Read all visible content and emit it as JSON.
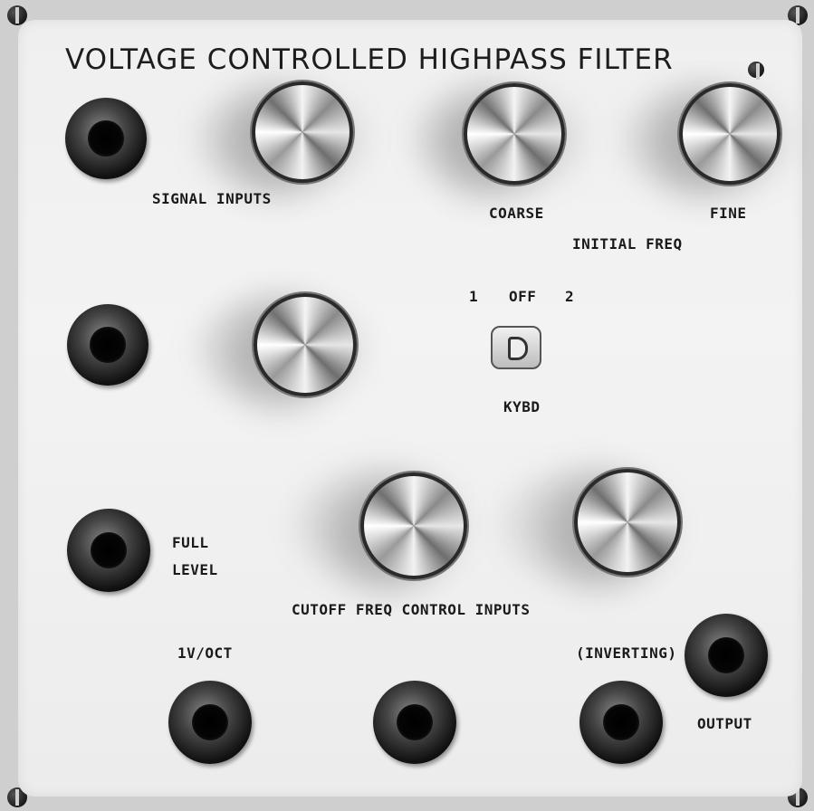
{
  "panel": {
    "title": "VOLTAGE CONTROLLED HIGHPASS FILTER"
  },
  "labels": {
    "signal_inputs": "SIGNAL INPUTS",
    "coarse": "COARSE",
    "fine": "FINE",
    "initial_freq": "INITIAL FREQ",
    "switch_1": "1",
    "switch_off": "OFF",
    "switch_2": "2",
    "kybd": "KYBD",
    "full": "FULL",
    "level": "LEVEL",
    "cutoff_freq_control_inputs": "CUTOFF FREQ CONTROL INPUTS",
    "v_oct": "1V/OCT",
    "inverting": "(INVERTING)",
    "output": "OUTPUT"
  },
  "colors": {
    "panel": "#efefef",
    "frame": "#cfcfcf",
    "text": "#1a1a1a"
  }
}
